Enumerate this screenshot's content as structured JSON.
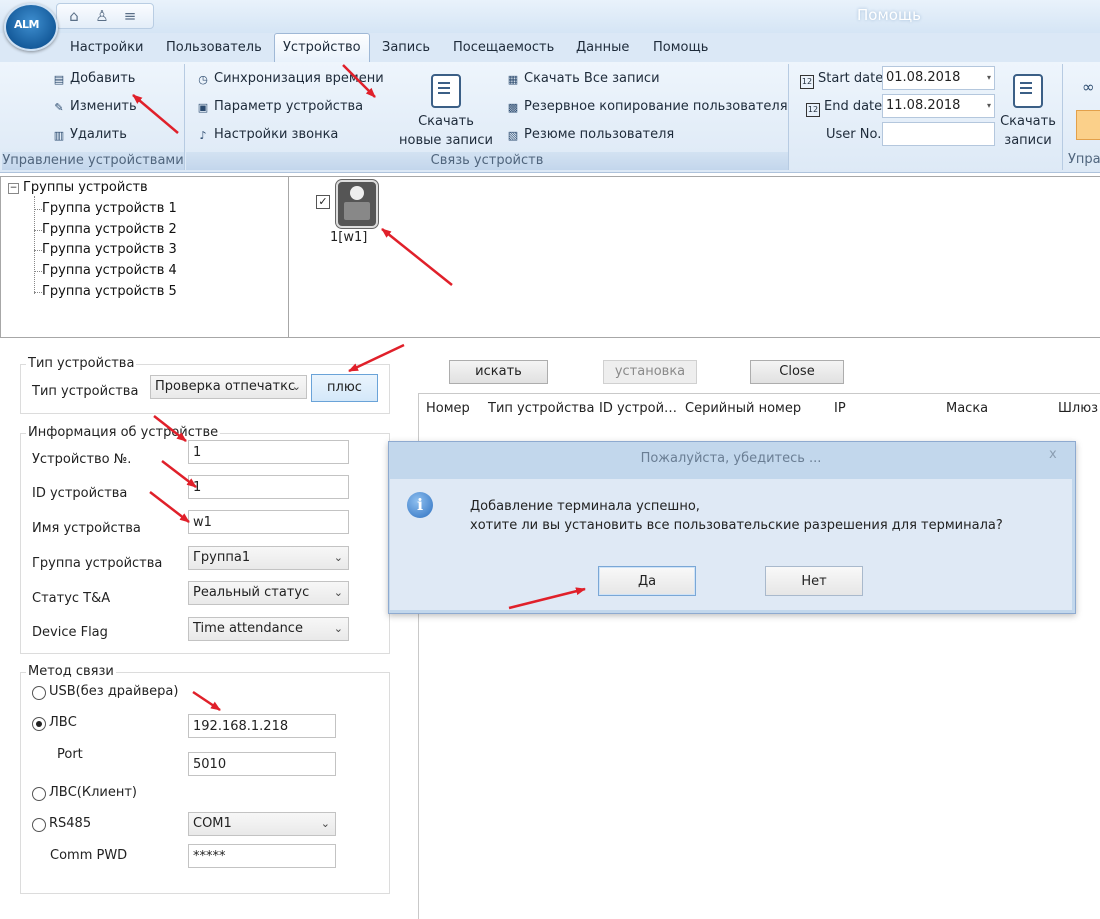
{
  "app": {
    "logo_text": "ALM",
    "title": "Помощь"
  },
  "tabs": [
    {
      "label": "Настройки",
      "active": false
    },
    {
      "label": "Пользователь",
      "active": false
    },
    {
      "label": "Устройство",
      "active": true
    },
    {
      "label": "Запись",
      "active": false
    },
    {
      "label": "Посещаемость",
      "active": false
    },
    {
      "label": "Данные",
      "active": false
    },
    {
      "label": "Помощь",
      "active": false
    }
  ],
  "ribbon": {
    "device_mgmt": {
      "add": "Добавить",
      "edit": "Изменить",
      "delete": "Удалить",
      "group_label": "Управление устройствами"
    },
    "device_link": {
      "sync_time": "Синхронизация времени",
      "device_param": "Параметр устройства",
      "bell_settings": "Настройки звонка",
      "download_new_records": "Скачать\nновые записи",
      "download_all_records": "Скачать Все записи",
      "backup_users": "Резервное копирование пользователя",
      "user_summary": "Резюме пользователя",
      "group_label": "Связь устройств"
    },
    "records": {
      "start_date_label": "Start date",
      "start_date": "01.08.2018",
      "end_date_label": "End date",
      "end_date": "11.08.2018",
      "user_no_label": "User No.",
      "user_no": "",
      "download_records": "Скачать\nзаписи"
    },
    "cut_group_label": "Упра"
  },
  "tree": {
    "root": "Группы устройств",
    "items": [
      "Группа устройств 1",
      "Группа устройств 2",
      "Группа устройств 3",
      "Группа устройств 4",
      "Группа устройств 5"
    ]
  },
  "device": {
    "label": "1[w1]",
    "checked": "✓"
  },
  "form": {
    "device_type_section": "Тип устройства",
    "device_type_label": "Тип устройства",
    "device_type_value": "Проверка отпечаткс",
    "plus_button": "плюс",
    "info_section": "Информация об устройстве",
    "device_no_label": "Устройство №.",
    "device_no": "1",
    "device_id_label": "ID устройства",
    "device_id": "1",
    "device_name_label": "Имя устройства",
    "device_name": "w1",
    "device_group_label": "Группа устройства",
    "device_group": "Группа1",
    "ta_status_label": "Статус T&A",
    "ta_status": "Реальный статус",
    "device_flag_label": "Device Flag",
    "device_flag": "Time attendance",
    "comm_section": "Метод связи",
    "usb_label": "USB(без драйвера)",
    "lan_label": "ЛВС",
    "ip": "192.168.1.218",
    "port_label": "Port",
    "port": "5010",
    "lan_client_label": "ЛВС(Клиент)",
    "rs485_label": "RS485",
    "com_port": "COM1",
    "comm_pwd_label": "Comm PWD",
    "comm_pwd": "*****"
  },
  "search": {
    "search_btn": "искать",
    "install_btn": "установка",
    "close_btn": "Close"
  },
  "table": {
    "columns": [
      "Номер",
      "Тип устройства",
      "ID устрой…",
      "Серийный номер",
      "IP",
      "Маска",
      "Шлюз"
    ]
  },
  "dialog": {
    "title": "Пожалуйста, убедитесь ...",
    "close": "x",
    "line1": "Добавление терминала успешно,",
    "line2": "хотите ли вы установить все пользовательские разрешения для терминала?",
    "yes": "Да",
    "no": "Нет"
  },
  "colors": {
    "annotation_arrow": "#e0202a",
    "ribbon_bg": "#dde9f6",
    "dialog_bg": "#dfe9f5"
  }
}
